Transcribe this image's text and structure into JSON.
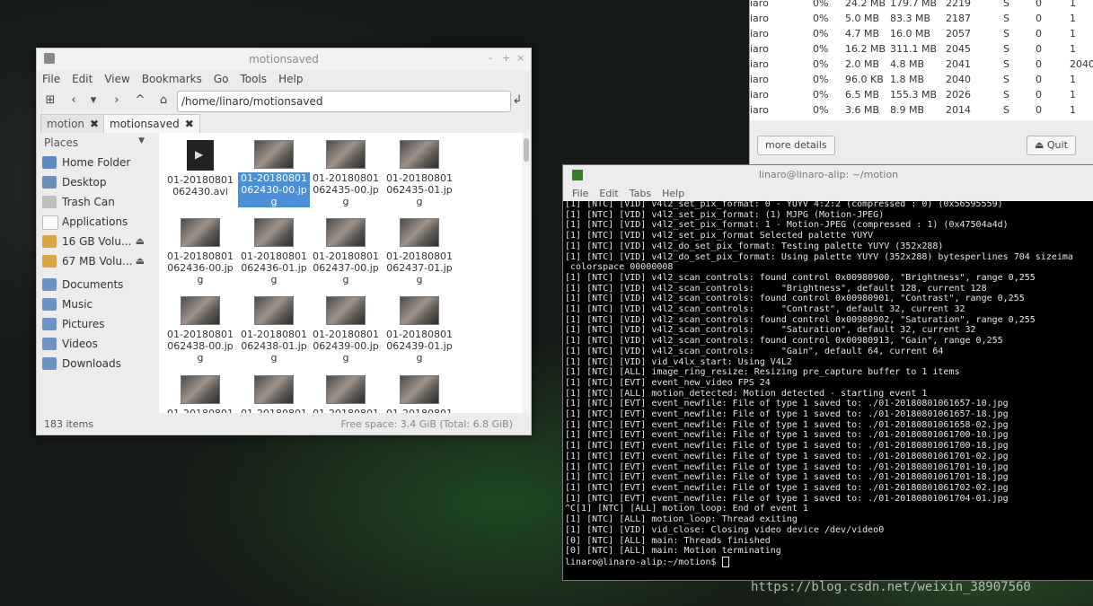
{
  "file_manager": {
    "title": "motionsaved",
    "menu": [
      "File",
      "Edit",
      "View",
      "Bookmarks",
      "Go",
      "Tools",
      "Help"
    ],
    "location": "/home/linaro/motionsaved",
    "tabs": [
      {
        "label": "motion"
      },
      {
        "label": "motionsaved"
      }
    ],
    "tab_close": "✖",
    "places_header": "Places",
    "places": [
      {
        "label": "Home Folder",
        "icon": "home-folder-icon"
      },
      {
        "label": "Desktop",
        "icon": "desktop-icon"
      },
      {
        "label": "Trash Can",
        "icon": "trash-icon"
      },
      {
        "label": "Applications",
        "icon": "applications-icon"
      },
      {
        "label": "16 GB Volu...",
        "icon": "drive-icon",
        "eject": "⏏"
      },
      {
        "label": "67 MB Volu...",
        "icon": "drive-icon",
        "eject": "⏏"
      }
    ],
    "bookmarks": [
      {
        "label": "Documents",
        "icon": "folder-icon"
      },
      {
        "label": "Music",
        "icon": "folder-icon"
      },
      {
        "label": "Pictures",
        "icon": "folder-icon"
      },
      {
        "label": "Videos",
        "icon": "folder-icon"
      },
      {
        "label": "Downloads",
        "icon": "folder-icon"
      }
    ],
    "files": [
      {
        "name": "01-20180801 062430.avi",
        "type": "video",
        "selected": false
      },
      {
        "name": "01-20180801 062430-00.jpg",
        "type": "image",
        "selected": true
      },
      {
        "name": "01-20180801 062435-00.jpg",
        "type": "image",
        "selected": false
      },
      {
        "name": "01-20180801 062435-01.jpg",
        "type": "image",
        "selected": false
      },
      {
        "name": "01-20180801 062436-00.jpg",
        "type": "image",
        "selected": false
      },
      {
        "name": "01-20180801 062436-01.jpg",
        "type": "image",
        "selected": false
      },
      {
        "name": "01-20180801 062437-00.jpg",
        "type": "image",
        "selected": false
      },
      {
        "name": "01-20180801 062437-01.jpg",
        "type": "image",
        "selected": false
      },
      {
        "name": "01-20180801 062438-00.jpg",
        "type": "image",
        "selected": false
      },
      {
        "name": "01-20180801 062438-01.jpg",
        "type": "image",
        "selected": false
      },
      {
        "name": "01-20180801 062439-00.jpg",
        "type": "image",
        "selected": false
      },
      {
        "name": "01-20180801 062439-01.jpg",
        "type": "image",
        "selected": false
      },
      {
        "name": "01-20180801",
        "type": "image",
        "selected": false
      },
      {
        "name": "01-20180801",
        "type": "image",
        "selected": false
      },
      {
        "name": "01-20180801",
        "type": "image",
        "selected": false
      },
      {
        "name": "01-20180801",
        "type": "image",
        "selected": false
      }
    ],
    "status_items": "183 items",
    "status_free": "Free space: 3.4 GiB (Total: 6.8 GiB)"
  },
  "task_manager": {
    "rows": [
      [
        "iaro",
        "0%",
        "24.2 MB",
        "179.7 MB",
        "2219",
        "S",
        "0",
        "1"
      ],
      [
        "iaro",
        "0%",
        "5.0 MB",
        "83.3 MB",
        "2187",
        "S",
        "0",
        "1"
      ],
      [
        "iaro",
        "0%",
        "4.7 MB",
        "16.0 MB",
        "2057",
        "S",
        "0",
        "1"
      ],
      [
        "iaro",
        "0%",
        "16.2 MB",
        "311.1 MB",
        "2045",
        "S",
        "0",
        "1"
      ],
      [
        "iaro",
        "0%",
        "2.0 MB",
        "4.8 MB",
        "2041",
        "S",
        "0",
        "2040"
      ],
      [
        "iaro",
        "0%",
        "96.0 KB",
        "1.8 MB",
        "2040",
        "S",
        "0",
        "1"
      ],
      [
        "iaro",
        "0%",
        "6.5 MB",
        "155.3 MB",
        "2026",
        "S",
        "0",
        "1"
      ],
      [
        "iaro",
        "0%",
        "3.6 MB",
        "8.9 MB",
        "2014",
        "S",
        "0",
        "1"
      ]
    ],
    "more_details": "more details",
    "quit": "Quit"
  },
  "terminal": {
    "title": "linaro@linaro-alip: ~/motion",
    "menu": [
      "File",
      "Edit",
      "Tabs",
      "Help"
    ],
    "lines": [
      "[1] [NTC] [VID] v4l2_set_pix_format: 0 - YUYV 4:2:2 (compressed : 0) (0x56595559)",
      "[1] [NTC] [VID] v4l2_set_pix_format: (1) MJPG (Motion-JPEG)",
      "[1] [NTC] [VID] v4l2_set_pix_format: 1 - Motion-JPEG (compressed : 1) (0x47504a4d)",
      "[1] [NTC] [VID] v4l2_set_pix_format Selected palette YUYV",
      "[1] [NTC] [VID] v4l2_do_set_pix_format: Testing palette YUYV (352x288)",
      "[1] [NTC] [VID] v4l2_do_set_pix_format: Using palette YUYV (352x288) bytesperlines 704 sizeima",
      " colorspace 00000008",
      "[1] [NTC] [VID] v4l2_scan_controls: found control 0x00980900, \"Brightness\", range 0,255",
      "[1] [NTC] [VID] v4l2_scan_controls:     \"Brightness\", default 128, current 128",
      "[1] [NTC] [VID] v4l2_scan_controls: found control 0x00980901, \"Contrast\", range 0,255",
      "[1] [NTC] [VID] v4l2_scan_controls:     \"Contrast\", default 32, current 32",
      "[1] [NTC] [VID] v4l2_scan_controls: found control 0x00980902, \"Saturation\", range 0,255",
      "[1] [NTC] [VID] v4l2_scan_controls:     \"Saturation\", default 32, current 32",
      "[1] [NTC] [VID] v4l2_scan_controls: found control 0x00980913, \"Gain\", range 0,255",
      "[1] [NTC] [VID] v4l2_scan_controls:     \"Gain\", default 64, current 64",
      "[1] [NTC] [VID] vid_v4lx_start: Using V4L2",
      "[1] [NTC] [ALL] image_ring_resize: Resizing pre_capture buffer to 1 items",
      "[1] [NTC] [EVT] event_new_video FPS 24",
      "[1] [NTC] [ALL] motion_detected: Motion detected - starting event 1",
      "[1] [NTC] [EVT] event_newfile: File of type 1 saved to: ./01-20180801061657-10.jpg",
      "[1] [NTC] [EVT] event_newfile: File of type 1 saved to: ./01-20180801061657-18.jpg",
      "[1] [NTC] [EVT] event_newfile: File of type 1 saved to: ./01-20180801061658-02.jpg",
      "[1] [NTC] [EVT] event_newfile: File of type 1 saved to: ./01-20180801061700-10.jpg",
      "[1] [NTC] [EVT] event_newfile: File of type 1 saved to: ./01-20180801061700-18.jpg",
      "[1] [NTC] [EVT] event_newfile: File of type 1 saved to: ./01-20180801061701-02.jpg",
      "[1] [NTC] [EVT] event_newfile: File of type 1 saved to: ./01-20180801061701-10.jpg",
      "[1] [NTC] [EVT] event_newfile: File of type 1 saved to: ./01-20180801061701-18.jpg",
      "[1] [NTC] [EVT] event_newfile: File of type 1 saved to: ./01-20180801061702-02.jpg",
      "[1] [NTC] [EVT] event_newfile: File of type 1 saved to: ./01-20180801061704-01.jpg",
      "^C[1] [NTC] [ALL] motion_loop: End of event 1",
      "[1] [NTC] [ALL] motion_loop: Thread exiting",
      "[1] [NTC] [VID] vid_close: Closing video device /dev/video0",
      "[0] [NTC] [ALL] main: Threads finished",
      "[0] [NTC] [ALL] main: Motion terminating",
      "linaro@linaro-alip:~/motion$ "
    ]
  },
  "watermark": "https://blog.csdn.net/weixin_38907560"
}
